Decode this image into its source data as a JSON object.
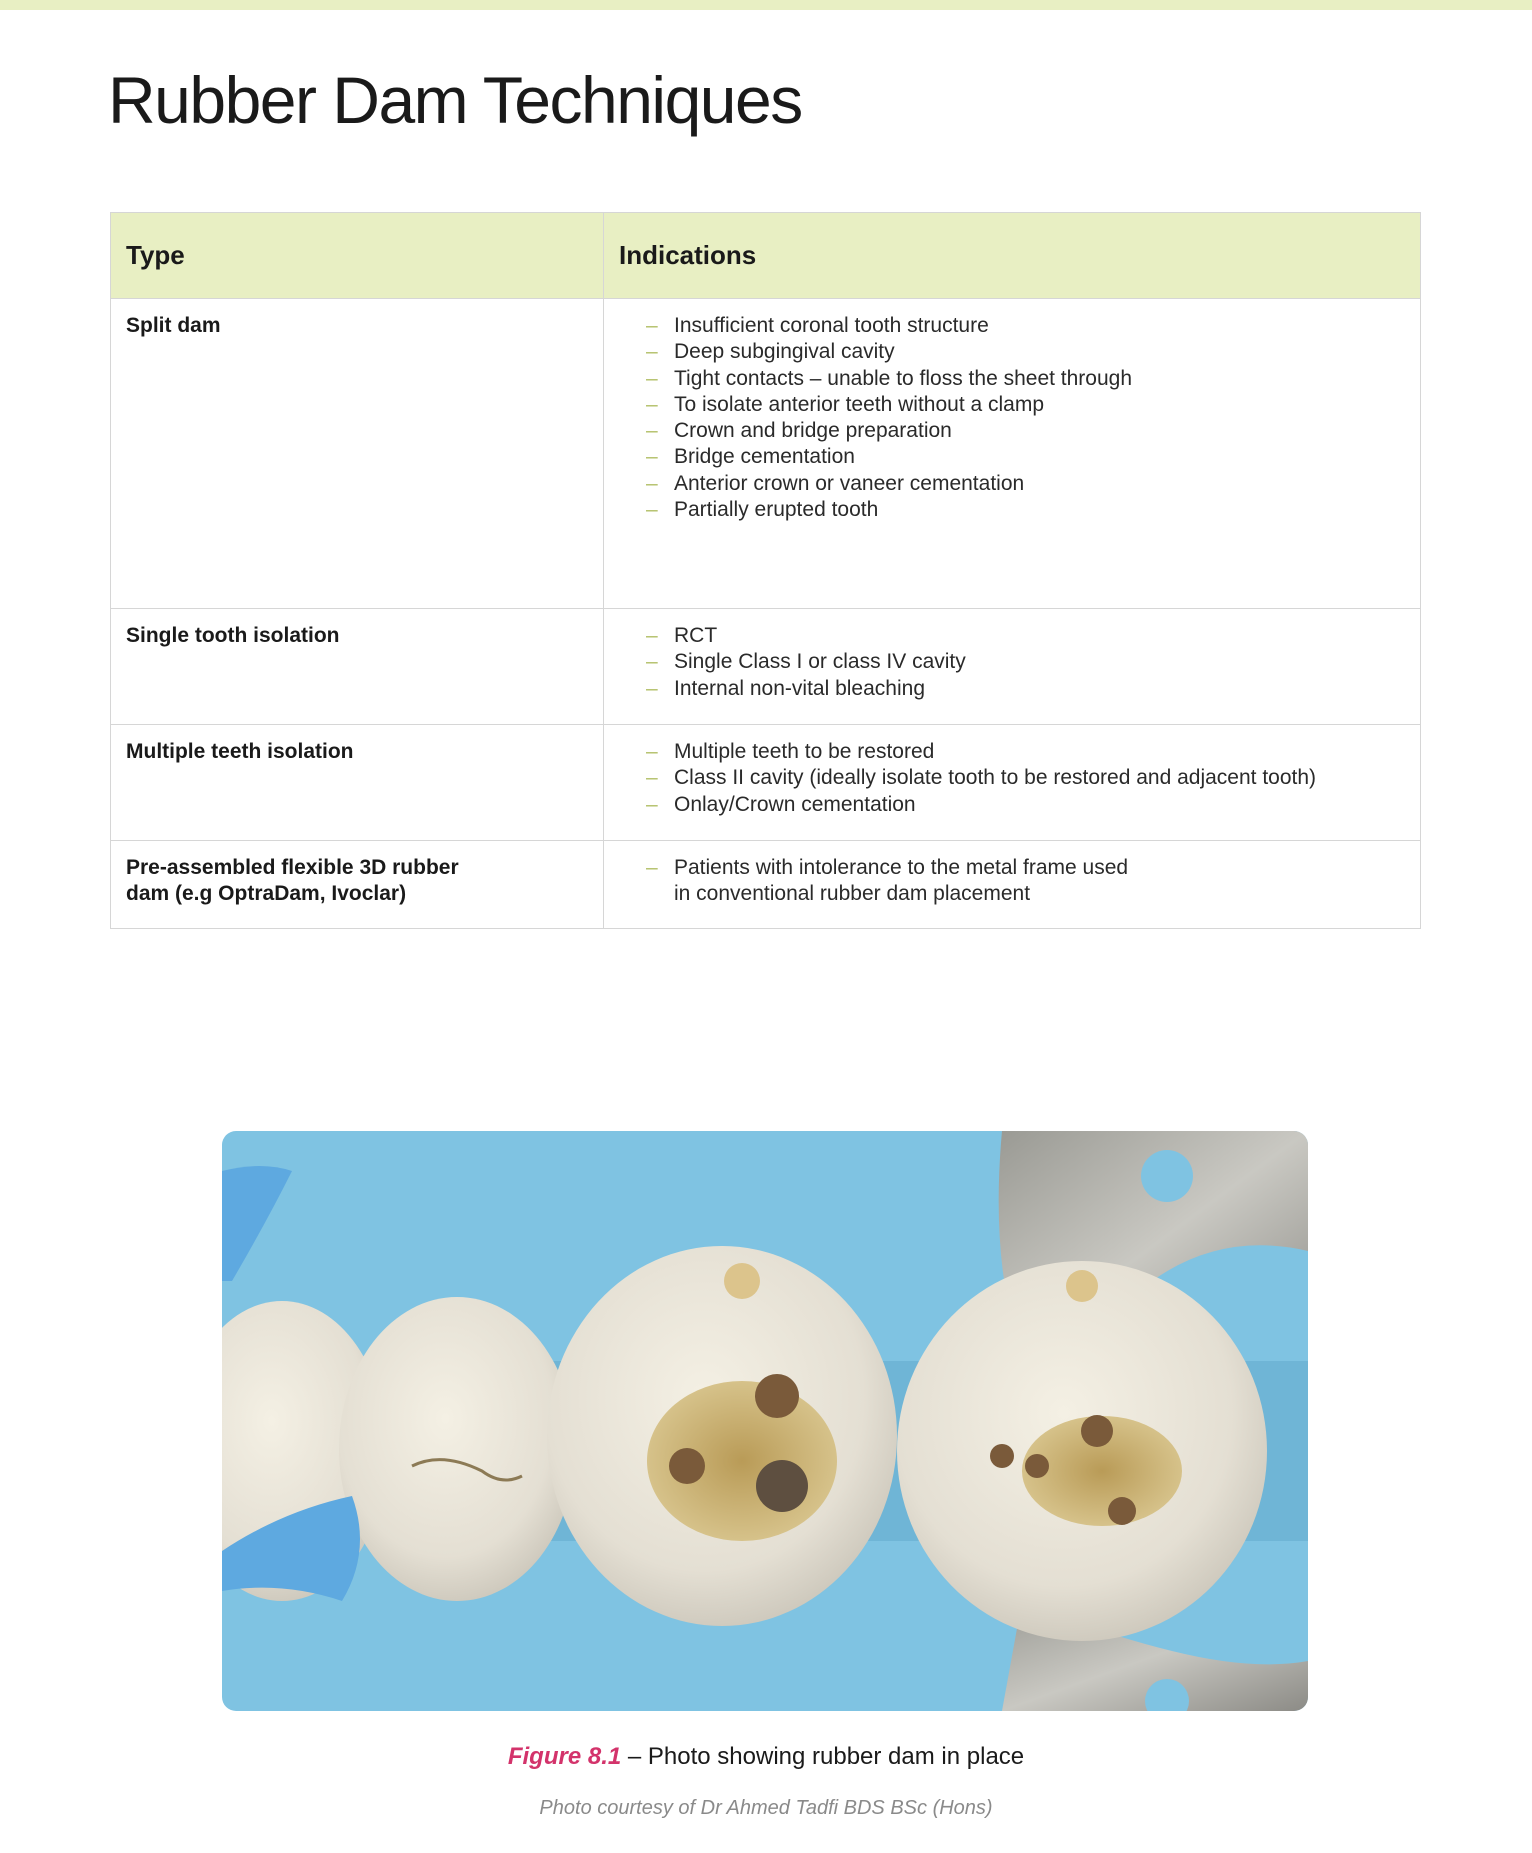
{
  "page": {
    "title": "Rubber Dam Techniques",
    "accent": "#e8efc3"
  },
  "table": {
    "headers": {
      "type": "Type",
      "indications": "Indications"
    },
    "rows": [
      {
        "type": "Split dam",
        "indications": [
          "Insufficient coronal tooth structure",
          "Deep subgingival cavity",
          "Tight contacts – unable to floss the sheet through",
          "To isolate anterior teeth without a clamp",
          "Crown and bridge preparation",
          "Bridge cementation",
          "Anterior crown or vaneer cementation",
          "Partially erupted tooth"
        ]
      },
      {
        "type": "Single tooth isolation",
        "indications": [
          "RCT",
          "Single Class I or class IV cavity",
          "Internal non-vital bleaching"
        ]
      },
      {
        "type": "Multiple teeth isolation",
        "indications": [
          "Multiple teeth to be restored",
          "Class II cavity (ideally isolate tooth to be restored and adjacent tooth)",
          "Onlay/Crown cementation"
        ]
      },
      {
        "type_lines": [
          "Pre-assembled flexible 3D rubber",
          "dam (e.g OptraDam, Ivoclar)"
        ],
        "indication_lines": [
          "Patients with intolerance to the metal frame used",
          "in conventional rubber dam placement"
        ]
      }
    ]
  },
  "figure": {
    "label": "Figure 8.1",
    "text": " – Photo showing rubber dam in place",
    "credit": "Photo courtesy of Dr Ahmed Tadfi BDS BSc (Hons)",
    "label_color": "#d3336b"
  }
}
